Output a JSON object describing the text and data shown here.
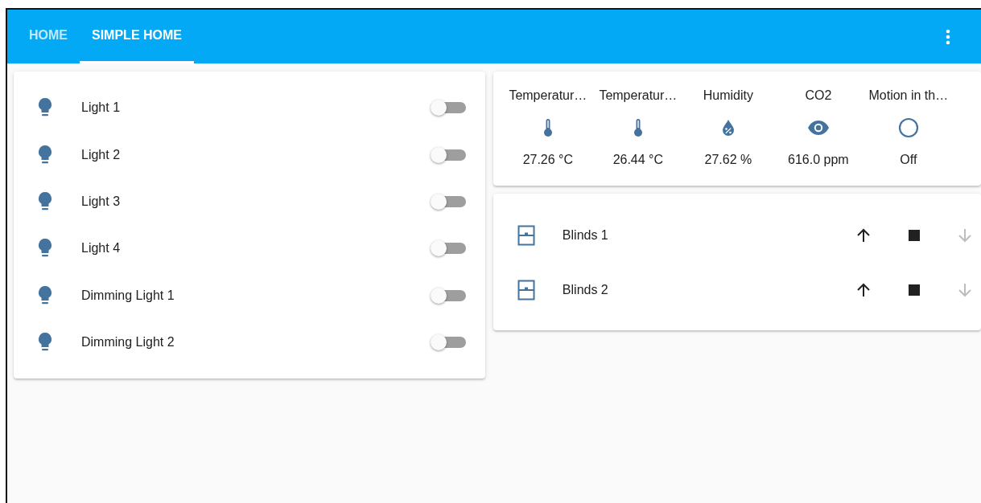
{
  "tabs": [
    {
      "label": "HOME",
      "selected": false
    },
    {
      "label": "SIMPLE HOME",
      "selected": true
    }
  ],
  "lights": [
    {
      "name": "Light 1",
      "on": false
    },
    {
      "name": "Light 2",
      "on": false
    },
    {
      "name": "Light 3",
      "on": false
    },
    {
      "name": "Light 4",
      "on": false
    },
    {
      "name": "Dimming Light 1",
      "on": false
    },
    {
      "name": "Dimming Light 2",
      "on": false
    }
  ],
  "sensors": [
    {
      "label": "Temperatur…",
      "kind": "thermometer",
      "value": "27.26 °C"
    },
    {
      "label": "Temperatur…",
      "kind": "thermometer",
      "value": "26.44 °C"
    },
    {
      "label": "Humidity",
      "kind": "humidity",
      "value": "27.62 %"
    },
    {
      "label": "CO2",
      "kind": "eye",
      "value": "616.0 ppm"
    },
    {
      "label": "Motion in th…",
      "kind": "motion",
      "value": "Off"
    }
  ],
  "blinds": [
    {
      "name": "Blinds 1",
      "up_disabled": false,
      "stop_disabled": false,
      "down_disabled": true
    },
    {
      "name": "Blinds 2",
      "up_disabled": false,
      "stop_disabled": false,
      "down_disabled": true
    }
  ]
}
